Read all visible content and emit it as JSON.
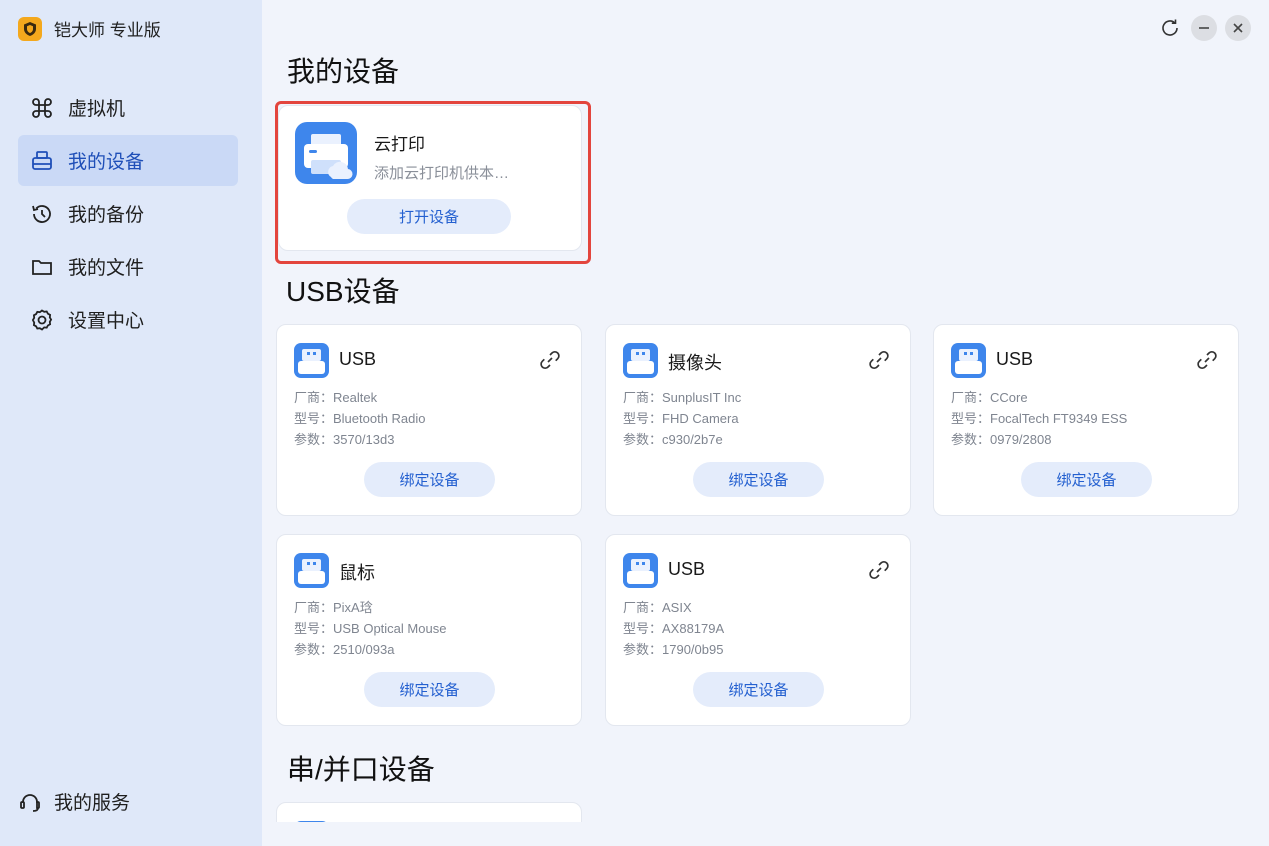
{
  "app": {
    "title": "铠大师 专业版",
    "logo_icon": "shield-logo-icon",
    "accent": "#f4a81d"
  },
  "sidebar": {
    "items": [
      {
        "label": "虚拟机",
        "icon": "command-icon",
        "active": false
      },
      {
        "label": "我的设备",
        "icon": "device-icon",
        "active": true
      },
      {
        "label": "我的备份",
        "icon": "history-icon",
        "active": false
      },
      {
        "label": "我的文件",
        "icon": "folder-icon",
        "active": false
      },
      {
        "label": "设置中心",
        "icon": "gear-icon",
        "active": false
      }
    ],
    "service_label": "我的服务"
  },
  "window_controls": [
    "refresh-icon",
    "minimize-icon",
    "close-icon"
  ],
  "sections": {
    "my_devices": "我的设备",
    "usb_devices": "USB设备",
    "serial_devices": "串/并口设备"
  },
  "cloud_print": {
    "title": "云打印",
    "description": "添加云打印机供本…",
    "button": "打开设备"
  },
  "usb_devices": [
    {
      "name": "USB",
      "vendor": "厂商：Realtek",
      "model": "型号：Bluetooth Radio",
      "params": "参数：3570/13d3",
      "button": "绑定设备",
      "linkable": true
    },
    {
      "name": "摄像头",
      "vendor": "厂商：SunplusIT Inc",
      "model": "型号：FHD Camera",
      "params": "参数：c930/2b7e",
      "button": "绑定设备",
      "linkable": true
    },
    {
      "name": "USB",
      "vendor": "厂商：CCore",
      "model": "型号：FocalTech FT9349 ESS",
      "params": "参数：0979/2808",
      "button": "绑定设备",
      "linkable": true
    },
    {
      "name": "鼠标",
      "vendor": "厂商：PixA琀",
      "model": "型号：USB Optical Mouse",
      "params": "参数：2510/093a",
      "button": "绑定设备",
      "linkable": false
    },
    {
      "name": "USB",
      "vendor": "厂商：ASIX",
      "model": "型号：AX88179A",
      "params": "参数：1790/0b95",
      "button": "绑定设备",
      "linkable": true
    }
  ]
}
